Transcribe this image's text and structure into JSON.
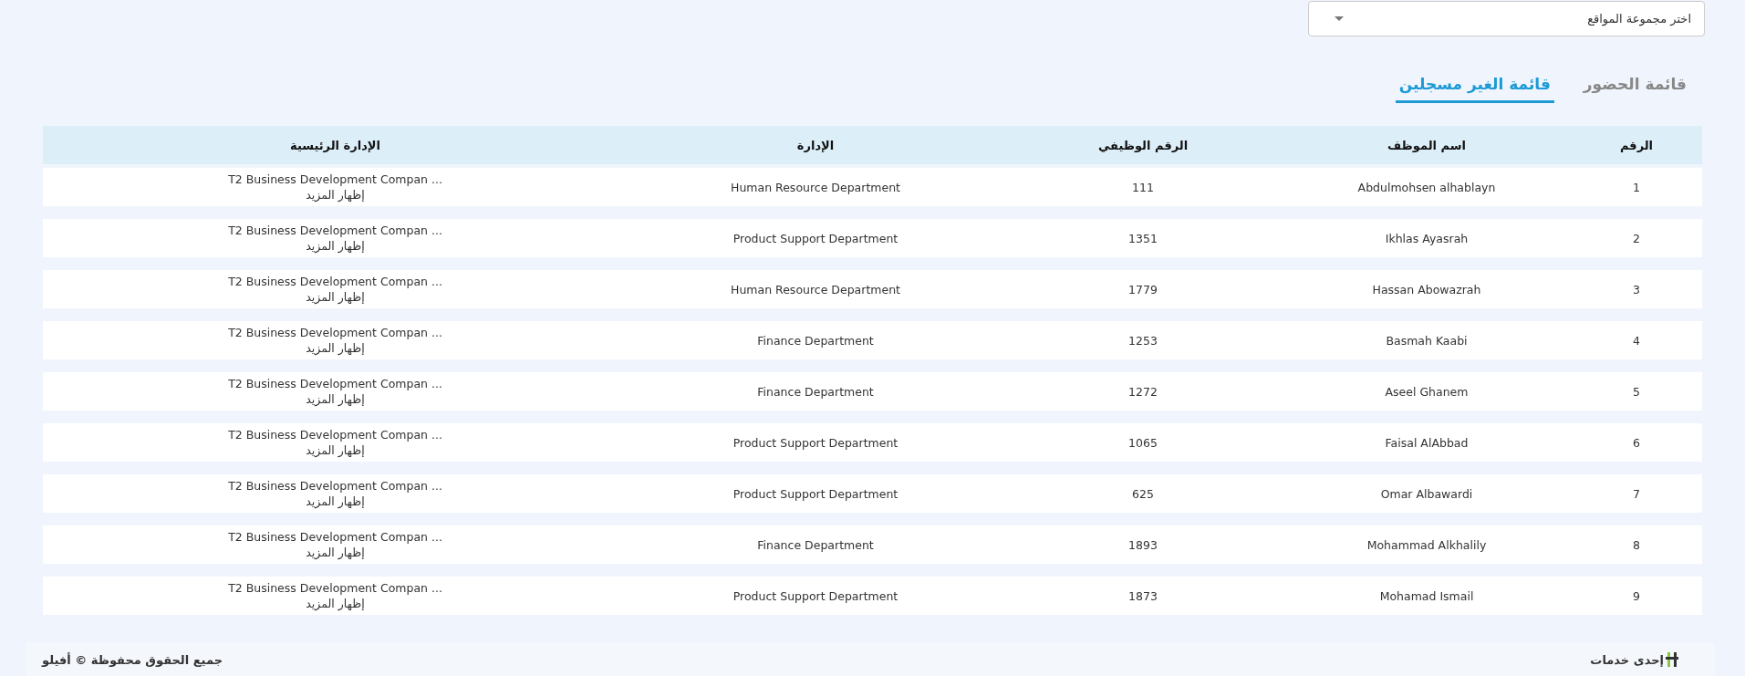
{
  "site_group_select": {
    "placeholder": "اختر مجموعة المواقع"
  },
  "tabs": [
    {
      "label": "قائمة الحضور",
      "selected": false
    },
    {
      "label": "قائمة الغير مسجلين",
      "selected": true
    }
  ],
  "table": {
    "columns": [
      "الرقم",
      "اسم الموظف",
      "الرقم الوظيفي",
      "الإدارة",
      "الإدارة الرئيسية"
    ],
    "rows": [
      {
        "number": "1",
        "name": "Abdulmohsen alhablayn",
        "employee_id": "111",
        "department": "Human Resource Department",
        "main_department": "T2 Business Development Compan ...",
        "show_more": "إظهار المزيد"
      },
      {
        "number": "2",
        "name": "Ikhlas Ayasrah",
        "employee_id": "1351",
        "department": "Product Support Department",
        "main_department": "T2 Business Development Compan ...",
        "show_more": "إظهار المزيد"
      },
      {
        "number": "3",
        "name": "Hassan Abowazrah",
        "employee_id": "1779",
        "department": "Human Resource Department",
        "main_department": "T2 Business Development Compan ...",
        "show_more": "إظهار المزيد"
      },
      {
        "number": "4",
        "name": "Basmah Kaabi",
        "employee_id": "1253",
        "department": "Finance Department",
        "main_department": "T2 Business Development Compan ...",
        "show_more": "إظهار المزيد"
      },
      {
        "number": "5",
        "name": "Aseel Ghanem",
        "employee_id": "1272",
        "department": "Finance Department",
        "main_department": "T2 Business Development Compan ...",
        "show_more": "إظهار المزيد"
      },
      {
        "number": "6",
        "name": "Faisal AlAbbad",
        "employee_id": "1065",
        "department": "Product Support Department",
        "main_department": "T2 Business Development Compan ...",
        "show_more": "إظهار المزيد"
      },
      {
        "number": "7",
        "name": "Omar Albawardi",
        "employee_id": "625",
        "department": "Product Support Department",
        "main_department": "T2 Business Development Compan ...",
        "show_more": "إظهار المزيد"
      },
      {
        "number": "8",
        "name": "Mohammad Alkhalily",
        "employee_id": "1893",
        "department": "Finance Department",
        "main_department": "T2 Business Development Compan ...",
        "show_more": "إظهار المزيد"
      },
      {
        "number": "9",
        "name": "Mohamad Ismail",
        "employee_id": "1873",
        "department": "Product Support Department",
        "main_department": "T2 Business Development Compan ...",
        "show_more": "إظهار المزيد"
      }
    ]
  },
  "footer": {
    "service_text": "إحدى خدمات",
    "copyright": "جميع الحقوق محفوظة © أفيلو"
  }
}
